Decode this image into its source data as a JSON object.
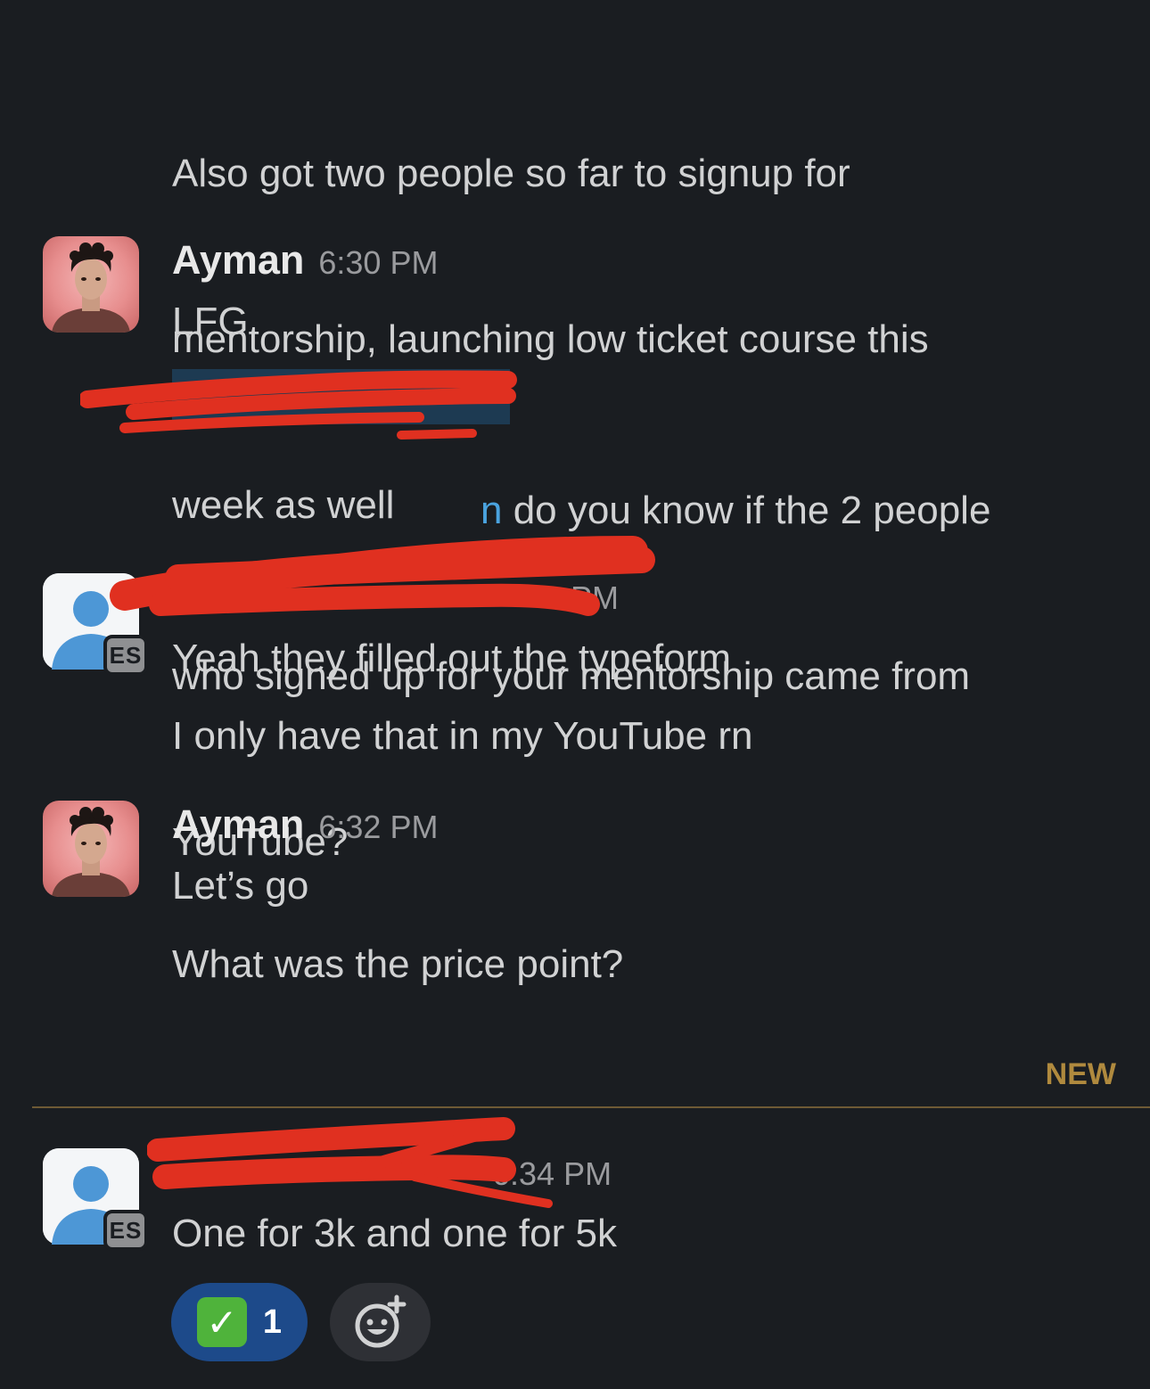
{
  "messages": {
    "m0_lines": [
      "Also got two people so far to signup for",
      "mentorship, launching low ticket course this",
      "week as well"
    ],
    "m1": {
      "author": "Ayman",
      "time": "6:30 PM",
      "text1": "LFG",
      "mention_visible": "n",
      "text2_first": " do you know if the 2 people",
      "text2_rest": [
        "who signed up for your mentorship came from",
        "YouTube?"
      ]
    },
    "m2": {
      "time": "PM",
      "text1": "Yeah they filled out the typeform",
      "text2": "I only have that in my YouTube rn",
      "badge": "ES"
    },
    "m3": {
      "author": "Ayman",
      "time": "6:32 PM",
      "text1": "Let’s go",
      "text2": "What was the price point?"
    },
    "divider": {
      "label": "NEW"
    },
    "m4": {
      "time": "6:34 PM",
      "text": "One for 3k and one for 5k",
      "badge": "ES",
      "reaction": {
        "emoji": "✓",
        "count": "1"
      },
      "add_reaction_icon": "add-reaction-icon"
    }
  },
  "colors": {
    "background": "#1a1d21",
    "text": "#d1d2d3",
    "timestamp": "#9a9b9e",
    "new_divider": "#b08a3e",
    "reaction_bg": "#1d4a8a",
    "redaction": "#e03020"
  }
}
